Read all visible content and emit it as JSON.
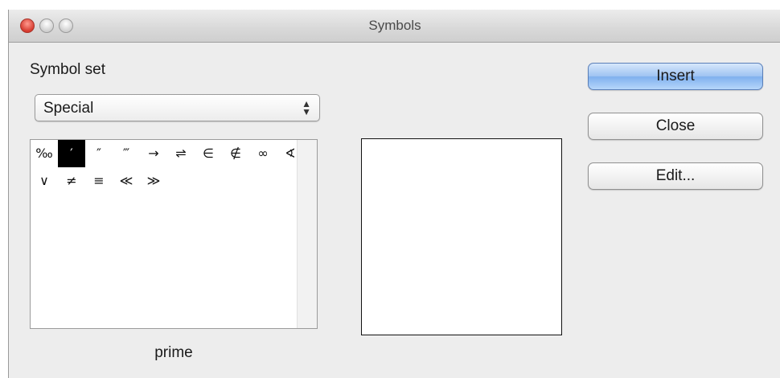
{
  "window": {
    "title": "Symbols"
  },
  "symbol_set": {
    "label": "Symbol set",
    "selected": "Special",
    "arrows_icon": "updown-arrows-icon"
  },
  "symbols": [
    "‰",
    "′",
    "″",
    "‴",
    "→",
    "⇌",
    "∈",
    "∉",
    "∞",
    "∢",
    "∨",
    "≠",
    "≡",
    "≪",
    "≫"
  ],
  "selected_index": 1,
  "preview": {
    "symbol": "′"
  },
  "symbol_name": "prime",
  "buttons": {
    "insert": "Insert",
    "close": "Close",
    "edit": "Edit..."
  },
  "colors": {
    "default_button": "#9ec3f2",
    "close_light": "#d63a2e"
  }
}
